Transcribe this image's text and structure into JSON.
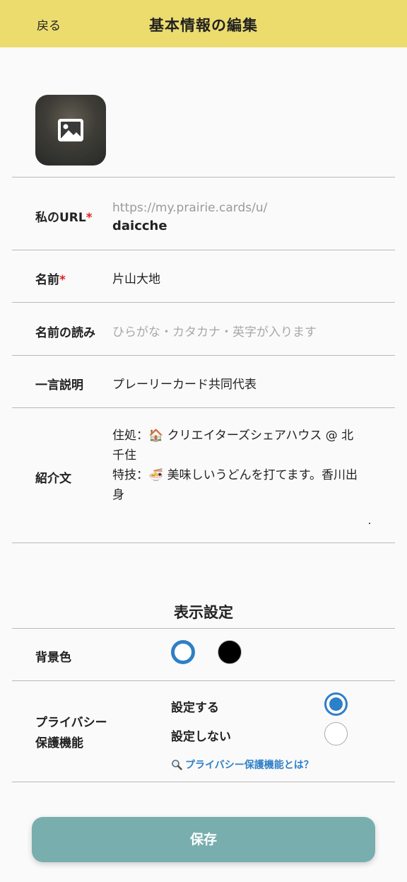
{
  "header": {
    "back_label": "戻る",
    "title": "基本情報の編集"
  },
  "avatar": {
    "icon": "image-upload-icon"
  },
  "fields": {
    "url": {
      "label": "私のURL",
      "required_mark": "*",
      "prefix": "https://my.prairie.cards/u/",
      "value": "daicche"
    },
    "name": {
      "label": "名前",
      "required_mark": "*",
      "value": "片山大地"
    },
    "reading": {
      "label": "名前の読み",
      "placeholder": "ひらがな・カタカナ・英字が入ります"
    },
    "tagline": {
      "label": "一言説明",
      "value": "プレーリーカード共同代表"
    },
    "intro": {
      "label": "紹介文",
      "lines": [
        "住処：🏠 クリエイターズシェアハウス @ 北",
        "千住",
        "特技：🍜 美味しいうどんを打てます。香川出",
        "身"
      ]
    }
  },
  "display_settings": {
    "title": "表示設定",
    "background": {
      "label": "背景色",
      "options": [
        "white",
        "black"
      ],
      "selected": "white",
      "colors": {
        "white": "#ffffff",
        "black": "#000000",
        "accent": "#2f7fc7"
      }
    },
    "privacy": {
      "label_line1": "プライバシー",
      "label_line2": "保護機能",
      "option_on": "設定する",
      "option_off": "設定しない",
      "selected": "設定する",
      "link": "プライバシー保護機能とは？"
    }
  },
  "save_label": "保存"
}
